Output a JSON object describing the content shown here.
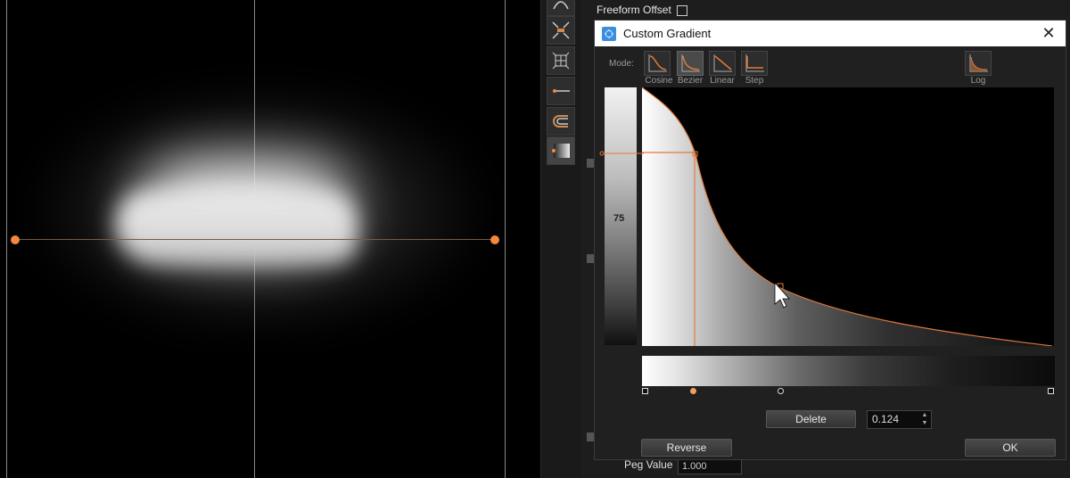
{
  "panel": {
    "freeform_offset_label": "Freeform Offset",
    "peg_value_label": "Peg Value",
    "peg_value": "1.000"
  },
  "dialog": {
    "title": "Custom Gradient",
    "mode_label": "Mode:",
    "modes": [
      {
        "label": "Cosine",
        "active": false
      },
      {
        "label": "Bezier",
        "active": true
      },
      {
        "label": "Linear",
        "active": false
      },
      {
        "label": "Step",
        "active": false
      }
    ],
    "log_label": "Log",
    "slider_value_label": "75",
    "delete_label": "Delete",
    "value_field": "0.124",
    "reverse_label": "Reverse",
    "ok_label": "OK"
  },
  "colors": {
    "accent": "#f08a40",
    "curve": "#e07a3a",
    "dialog_bg": "#202020",
    "titlebar": "#ffffff"
  },
  "icons": [
    "app-icon",
    "close-icon",
    "cosine-icon",
    "bezier-icon",
    "linear-icon",
    "step-icon",
    "log-icon"
  ]
}
